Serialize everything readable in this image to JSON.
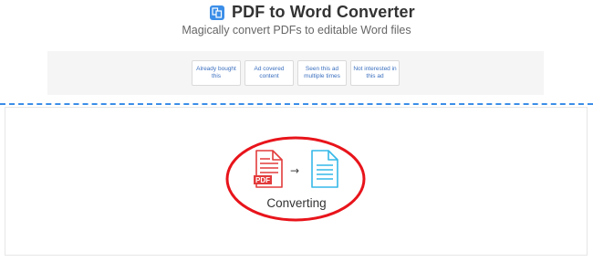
{
  "header": {
    "title": "PDF to Word Converter",
    "subtitle": "Magically convert PDFs to editable Word files",
    "icon": "app-logo-icon",
    "accent_color": "#3b8ee8"
  },
  "ad_feedback": {
    "buttons": [
      {
        "label": "Already bought this"
      },
      {
        "label": "Ad covered content"
      },
      {
        "label": "Seen this ad multiple times"
      },
      {
        "label": "Not interested in this ad"
      }
    ]
  },
  "converter": {
    "source_icon": "pdf-file-icon",
    "source_badge": "PDF",
    "arrow_glyph": "→",
    "target_icon": "document-file-icon",
    "status_label": "Converting",
    "highlight_color": "#e8141b"
  }
}
